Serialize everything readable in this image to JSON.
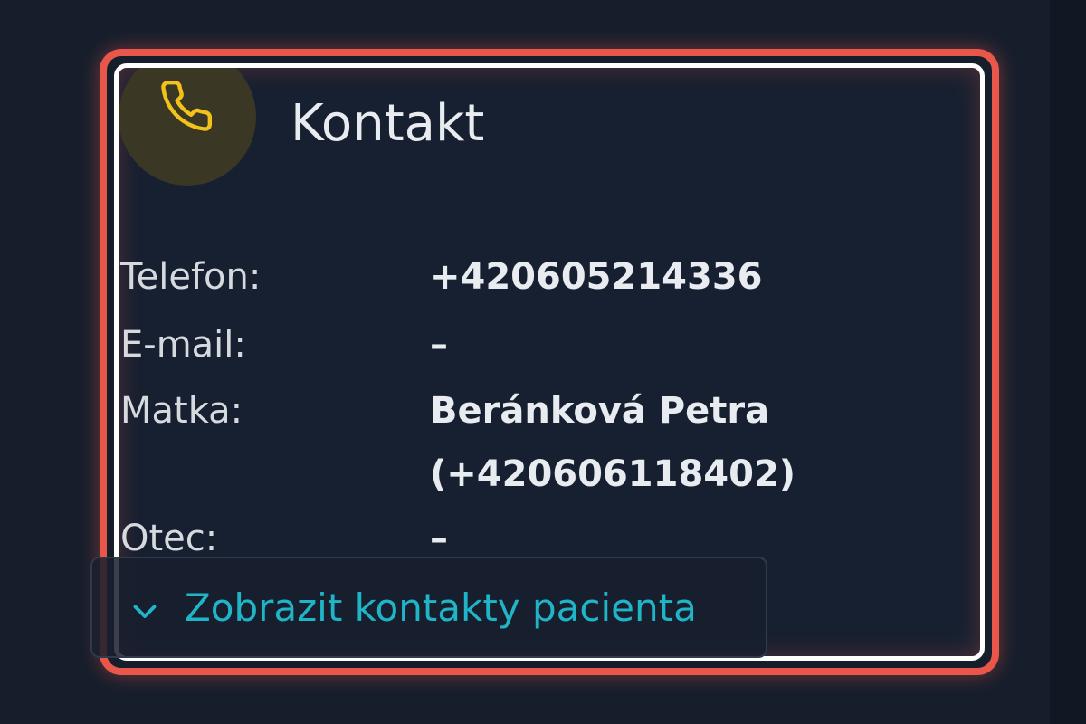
{
  "card": {
    "title": "Kontakt",
    "icon": "phone-icon"
  },
  "contact": {
    "phone_label": "Telefon:",
    "phone_value": "+420605214336",
    "email_label": "E-mail:",
    "email_value": "–",
    "mother_label": "Matka:",
    "mother_name": "Beránková Petra",
    "mother_phone": "(+420606118402)",
    "father_label": "Otec:",
    "father_value": "–"
  },
  "toggle": {
    "label": "Zobrazit kontakty pacienta",
    "icon": "chevron-down-icon"
  },
  "colors": {
    "accent": "#1fb5c7",
    "icon": "#f2c21b",
    "highlight": "#e8574a",
    "background": "#161e2c"
  }
}
